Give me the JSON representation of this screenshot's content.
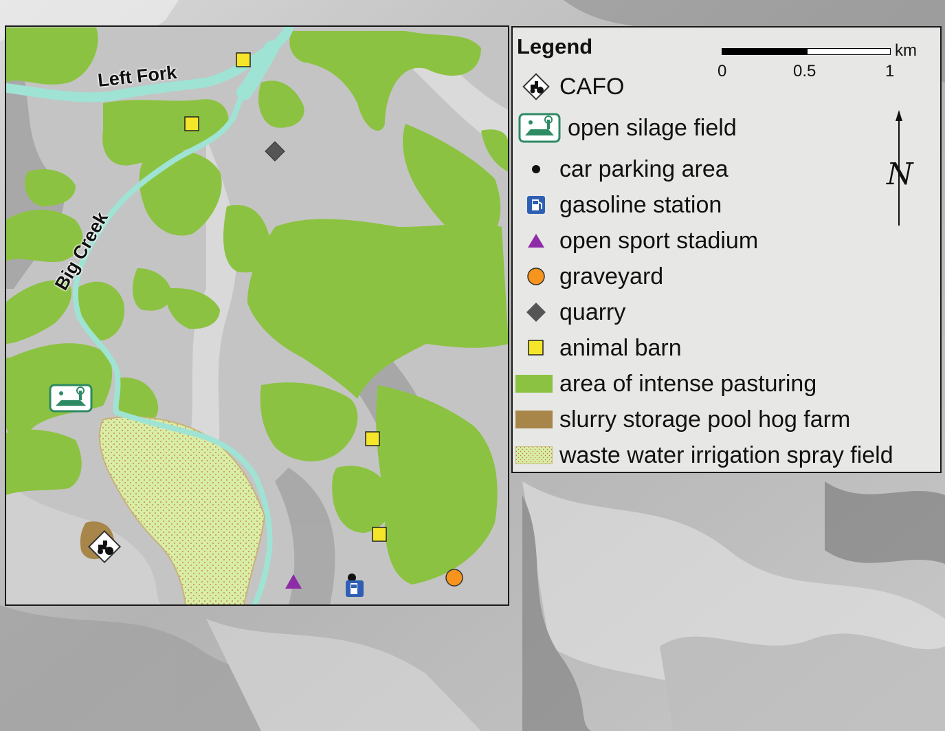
{
  "map": {
    "labels": {
      "left_fork": "Left Fork",
      "big_creek": "Big Creek"
    },
    "colors": {
      "pasture": "#8cc241",
      "creek": "#9fe3d4",
      "spray_field": "#d8eda6",
      "slurry": "#a8864a",
      "barn": "#f5e62a",
      "quarry": "#555555",
      "stadium": "#8e2ca7",
      "graveyard": "#f7941d",
      "gas_station": "#2f5fb4",
      "silage": "#2e8a63"
    }
  },
  "legend": {
    "title": "Legend",
    "items": [
      {
        "label": "CAFO",
        "icon": "cafo-tractor-icon"
      },
      {
        "label": "open silage field",
        "icon": "silage-field-icon"
      },
      {
        "label": "car parking area",
        "icon": "parking-dot-icon"
      },
      {
        "label": "gasoline station",
        "icon": "gas-pump-icon"
      },
      {
        "label": "open sport stadium",
        "icon": "triangle-icon"
      },
      {
        "label": "graveyard",
        "icon": "circle-icon"
      },
      {
        "label": "quarry",
        "icon": "diamond-icon"
      },
      {
        "label": "animal barn",
        "icon": "square-icon"
      },
      {
        "label": "area of intense pasturing",
        "icon": "green-swatch"
      },
      {
        "label": "slurry storage pool hog farm",
        "icon": "brown-swatch"
      },
      {
        "label": "waste water irrigation spray field",
        "icon": "dotted-swatch"
      }
    ],
    "scale": {
      "unit": "km",
      "ticks": [
        "0",
        "0.5",
        "1"
      ]
    },
    "north_letter": "N"
  }
}
